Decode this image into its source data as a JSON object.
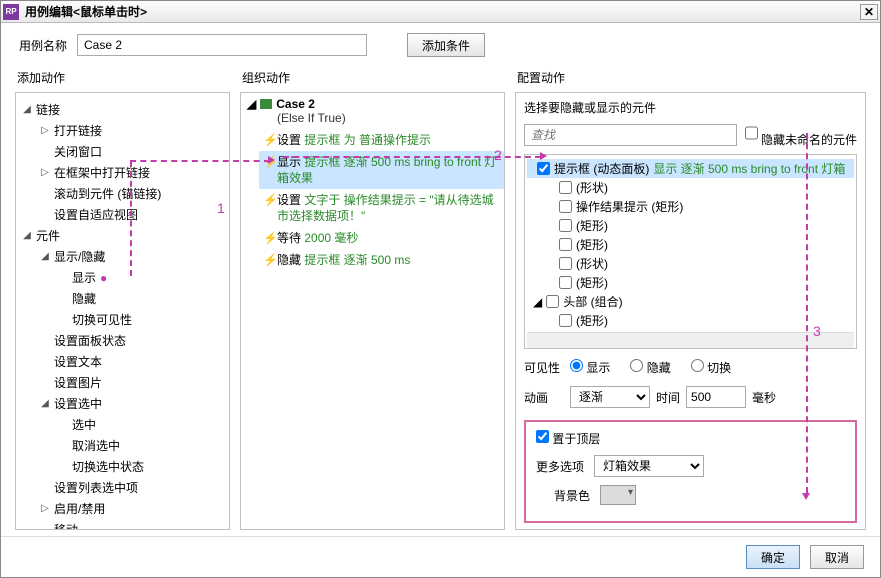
{
  "window": {
    "title": "用例编辑<鼠标单击时>",
    "app_icon": "RP"
  },
  "case": {
    "label": "用例名称",
    "name": "Case 2",
    "add_condition": "添加条件"
  },
  "columns": {
    "left": "添加动作",
    "mid": "组织动作",
    "right": "配置动作"
  },
  "left_tree": {
    "link": {
      "label": "链接",
      "open_link": "打开链接",
      "close_window": "关闭窗口",
      "open_in_frame": "在框架中打开链接",
      "scroll_to": "滚动到元件 (锚链接)",
      "adaptive": "设置自适应视图"
    },
    "widget": {
      "label": "元件",
      "show_hide": {
        "label": "显示/隐藏",
        "show": "显示",
        "hide": "隐藏",
        "toggle": "切换可见性"
      },
      "panel_state": "设置面板状态",
      "set_text": "设置文本",
      "set_image": "设置图片",
      "selected": {
        "label": "设置选中",
        "sel": "选中",
        "unsel": "取消选中",
        "toggle_sel": "切换选中状态"
      },
      "list_item": "设置列表选中项",
      "enable": "启用/禁用",
      "move": "移动"
    }
  },
  "mid": {
    "case_label": "Case 2",
    "else_label": "(Else If True)",
    "actions": [
      {
        "verb": "设置",
        "rest_a": "提示框",
        "rest_b": "为 普通操作提示"
      },
      {
        "verb": "显示",
        "rest_a": "提示框 逐渐 500 ms bring to front 灯箱效果",
        "selected": true
      },
      {
        "verb": "设置",
        "rest_a": "文字于",
        "rest_b": "操作结果提示 = \"请从待选城市选择数据项！\""
      },
      {
        "verb": "等待",
        "rest_a": "2000 毫秒"
      },
      {
        "verb": "隐藏",
        "rest_a": "提示框 逐渐 500 ms"
      }
    ]
  },
  "right": {
    "heading": "选择要隐藏或显示的元件",
    "search_ph": "查找",
    "hide_unnamed": "隐藏未命名的元件",
    "widgets": [
      {
        "label_a": "提示框 (动态面板)",
        "extra": "显示 逐渐 500 ms bring to front 灯箱",
        "checked": true,
        "indent": 0
      },
      {
        "label_a": "(形状)",
        "indent": 1
      },
      {
        "label_a": "操作结果提示 (矩形)",
        "indent": 1
      },
      {
        "label_a": "(矩形)",
        "indent": 1
      },
      {
        "label_a": "(矩形)",
        "indent": 1
      },
      {
        "label_a": "(形状)",
        "indent": 1
      },
      {
        "label_a": "(矩形)",
        "indent": 1
      },
      {
        "label_a": "头部 (组合)",
        "indent": 0,
        "group": true
      },
      {
        "label_a": "(矩形)",
        "indent": 1
      }
    ],
    "visibility": {
      "label": "可见性",
      "show": "显示",
      "hide": "隐藏",
      "toggle": "切换"
    },
    "anim": {
      "label": "动画",
      "value": "逐渐",
      "time_label": "时间",
      "time": "500",
      "unit": "毫秒"
    },
    "box": {
      "bring_front": "置于顶层",
      "more_label": "更多选项",
      "more_value": "灯箱效果",
      "bg_label": "背景色"
    }
  },
  "footer": {
    "ok": "确定",
    "cancel": "取消"
  },
  "anno": {
    "n1": "1",
    "n2": "2",
    "n3": "3"
  }
}
